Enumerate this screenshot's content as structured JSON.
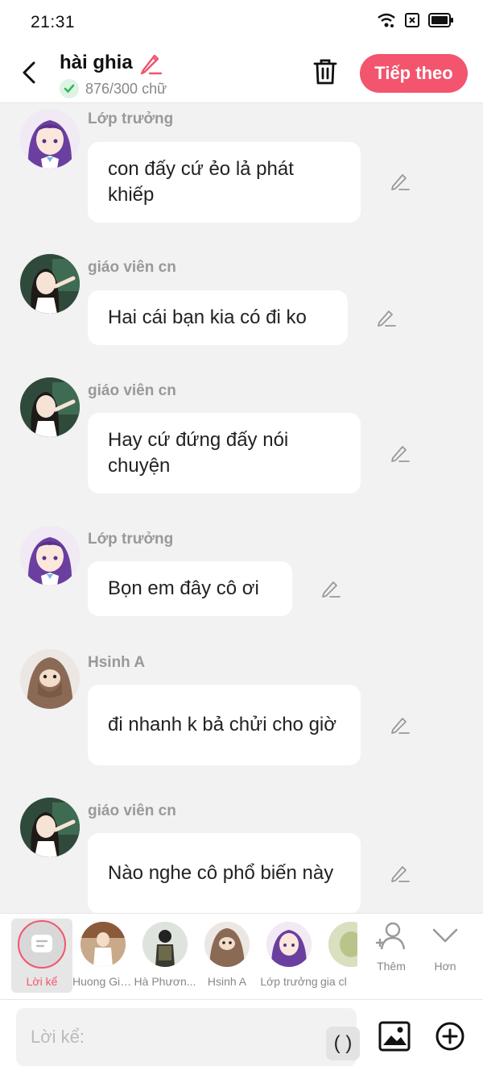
{
  "status": {
    "time": "21:31"
  },
  "header": {
    "title": "hài ghia",
    "word_count": "876/300 chữ",
    "next_label": "Tiếp theo"
  },
  "messages": [
    {
      "sender": "Lớp trưởng",
      "text": "con đấy cứ ẻo lả phát khiếp",
      "avatar": "purple-hair-girl-avatar"
    },
    {
      "sender": "giáo viên cn",
      "text": "Hai cái bạn kia có đi ko",
      "avatar": "teacher-avatar"
    },
    {
      "sender": "giáo viên cn",
      "text": "Hay cứ đứng đấy nói chuyện",
      "avatar": "teacher-avatar"
    },
    {
      "sender": "Lớp trưởng",
      "text": "Bọn em đây cô ơi",
      "avatar": "purple-hair-girl-avatar"
    },
    {
      "sender": "Hsinh A",
      "text": "đi nhanh k bả chửi cho giờ",
      "avatar": "hijab-girl-avatar"
    },
    {
      "sender": "giáo viên cn",
      "text": "Nào nghe cô phổ biến này",
      "avatar": "teacher-avatar"
    }
  ],
  "characters": {
    "narrator": "Lời kể",
    "items": [
      {
        "name": "Huong Gia..."
      },
      {
        "name": "Hà Phươn..."
      },
      {
        "name": "Hsinh A"
      },
      {
        "name": "Lớp trưởng"
      },
      {
        "name": "gia cl"
      }
    ],
    "add_label": "Thêm",
    "more_label": "Hơn"
  },
  "input": {
    "placeholder": "Lời kể:",
    "paren": "( )"
  },
  "colors": {
    "accent": "#f3546e",
    "background": "#f2f2f2",
    "bubble": "#ffffff"
  }
}
